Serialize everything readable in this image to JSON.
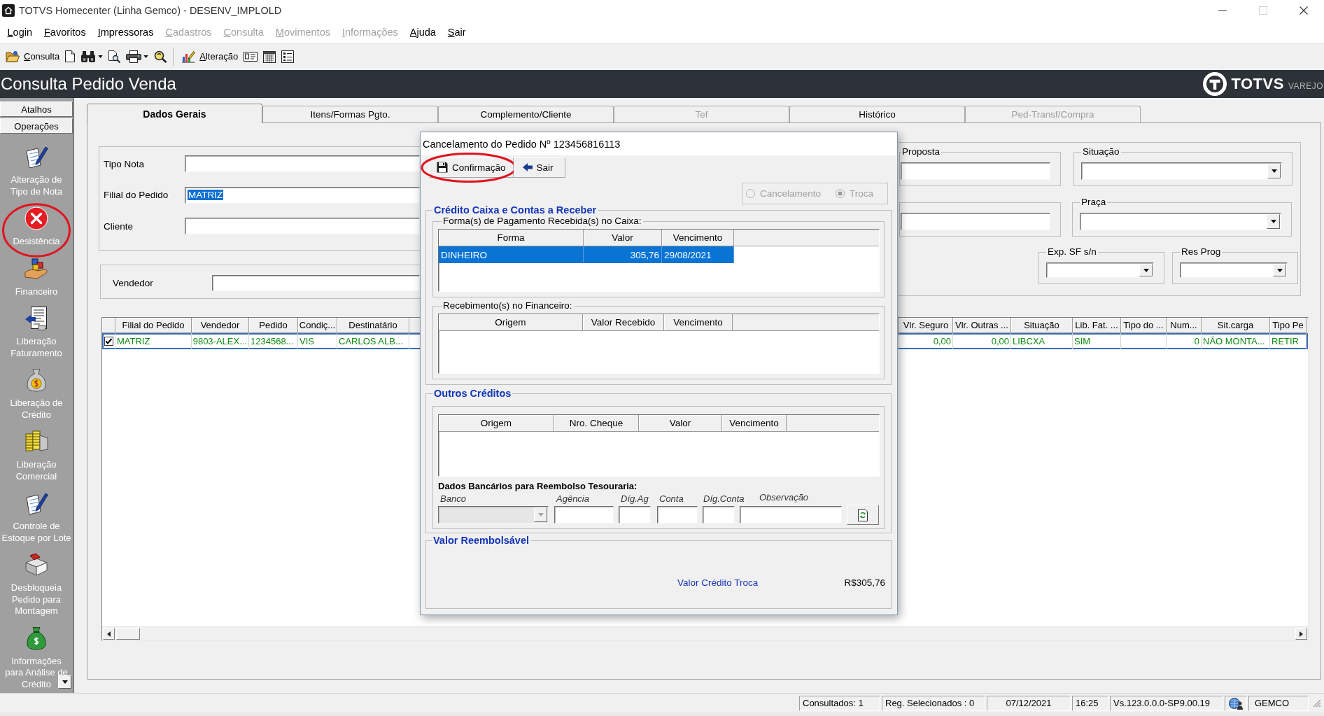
{
  "window": {
    "title": "TOTVS Homecenter (Linha Gemco) - DESENV_IMPLOLD"
  },
  "menu": [
    {
      "label": "Login",
      "disabled": false
    },
    {
      "label": "Favoritos",
      "disabled": false
    },
    {
      "label": "Impressoras",
      "disabled": false
    },
    {
      "label": "Cadastros",
      "disabled": true
    },
    {
      "label": "Consulta",
      "disabled": true
    },
    {
      "label": "Movimentos",
      "disabled": true
    },
    {
      "label": "Informações",
      "disabled": true
    },
    {
      "label": "Ajuda",
      "disabled": false
    },
    {
      "label": "Sair",
      "disabled": false
    }
  ],
  "toolbar": {
    "buttons": [
      {
        "label": "Consulta"
      },
      {
        "label": "Alteração"
      }
    ]
  },
  "page_header": {
    "title": "Consulta Pedido Venda",
    "logo_text": "TOTVS",
    "logo_subtext": "VAREJO"
  },
  "sidebar": {
    "sections": [
      "Atalhos",
      "Operações"
    ],
    "items": [
      {
        "label": "Alteração de\nTipo de Nota",
        "circled": false
      },
      {
        "label": "Desistência",
        "circled": true
      },
      {
        "label": "Financeiro",
        "circled": false
      },
      {
        "label": "Liberação\nFaturamento",
        "circled": false
      },
      {
        "label": "Liberação de\nCrédito",
        "circled": false
      },
      {
        "label": "Liberação\nComercial",
        "circled": false
      },
      {
        "label": "Controle de\nEstoque por Lote",
        "circled": false
      },
      {
        "label": "Desbloqueia\nPedido para\nMontagem",
        "circled": false
      },
      {
        "label": "Informações\npara Análise de\nCrédito",
        "circled": false
      }
    ]
  },
  "tabs": [
    {
      "label": "Dados Gerais",
      "selected": true,
      "disabled": false
    },
    {
      "label": "Itens/Formas Pgto.",
      "selected": false,
      "disabled": false
    },
    {
      "label": "Complemento/Cliente",
      "selected": false,
      "disabled": false
    },
    {
      "label": "Tef",
      "selected": false,
      "disabled": true
    },
    {
      "label": "Histórico",
      "selected": false,
      "disabled": false
    },
    {
      "label": "Ped-Transf/Compra",
      "selected": false,
      "disabled": true
    }
  ],
  "form": {
    "left_fields": [
      {
        "label": "Tipo Nota"
      },
      {
        "label": "Filial do Pedido",
        "value": "MATRIZ",
        "value_selected": true
      },
      {
        "label": "Cliente"
      }
    ],
    "vendor_field": {
      "label": "Vendedor"
    },
    "right_groups": [
      {
        "label": "Proposta",
        "kind": "text"
      },
      {
        "label": "Situação",
        "kind": "select"
      },
      {
        "kind": "text"
      },
      {
        "label": "Praça",
        "kind": "select"
      },
      {
        "label": "Exp. SF s/n",
        "kind": "select"
      },
      {
        "label": "Res Prog",
        "kind": "select"
      }
    ]
  },
  "table": {
    "columns": [
      "Filial do Pedido",
      "Vendedor",
      "Pedido",
      "Condiç...",
      "Destinatário",
      "Vlr. Seguro",
      "Vlr. Outras ...",
      "Situação",
      "Lib. Fat. ...",
      "Tipo do ...",
      "Num...",
      "Sit.carga",
      "Tipo Pe"
    ],
    "rows": [
      {
        "checked": true,
        "selected": true,
        "cells": [
          "MATRIZ",
          "9803-ALEX...",
          "1234568...",
          "VIS",
          "CARLOS ALB...",
          "0,00",
          "0,00",
          "LIBCXA",
          "SIM",
          null,
          "0",
          "NÃO MONTA...",
          "RETIR"
        ]
      }
    ]
  },
  "dialog": {
    "title": "Cancelamento do Pedido Nº 123456816113",
    "buttons": [
      {
        "label": "Confirmação",
        "circled": true
      },
      {
        "label": "Sair",
        "circled": false
      }
    ],
    "operation": {
      "disabled": true,
      "options": [
        {
          "label": "Cancelamento",
          "selected": false
        },
        {
          "label": "Troca",
          "selected": true
        }
      ]
    },
    "cash_credit": {
      "title": "Crédito Caixa e Contas a Receber",
      "payments": {
        "title": "Forma(s) de Pagamento Recebida(s) no Caixa:",
        "columns": [
          "Forma",
          "Valor",
          "Vencimento"
        ],
        "rows": [
          {
            "selected": true,
            "cells": [
              "DINHEIRO",
              "305,76",
              "29/08/2021"
            ]
          }
        ]
      },
      "receipts": {
        "title": "Recebimento(s) no Financeiro:",
        "columns": [
          "Origem",
          "Valor Recebido",
          "Vencimento"
        ]
      }
    },
    "other_credits": {
      "title": "Outros Créditos",
      "columns": [
        "Origem",
        "Nro. Cheque",
        "Valor",
        "Vencimento"
      ],
      "bank_title": "Dados Bancários para Reembolso Tesouraria:",
      "bank_fields": [
        {
          "label": "Banco",
          "kind": "select",
          "disabled": true
        },
        {
          "label": "Agência",
          "kind": "text",
          "disabled": false
        },
        {
          "label": "Díg.Ag",
          "kind": "text",
          "disabled": false
        },
        {
          "label": "Conta",
          "kind": "text",
          "disabled": false
        },
        {
          "label": "Díg.Conta",
          "kind": "text",
          "disabled": false
        },
        {
          "label": "Observação",
          "kind": "text",
          "disabled": false
        }
      ]
    },
    "refund": {
      "title": "Valor Reembolsável",
      "label": "Valor Crédito Troca",
      "value": "R$305,76"
    }
  },
  "status_bar": {
    "panels": [
      {
        "kind": "text",
        "text": "Consultados: 1"
      },
      {
        "kind": "text",
        "text": "Reg. Selecionados : 0"
      },
      {
        "kind": "text",
        "text": "07/12/2021"
      },
      {
        "kind": "text",
        "text": "16:25"
      },
      {
        "kind": "text",
        "text": "Vs.123.0.0.0-SP9.00.19"
      },
      {
        "kind": "icon"
      },
      {
        "kind": "text",
        "text": "GEMCO"
      }
    ]
  }
}
